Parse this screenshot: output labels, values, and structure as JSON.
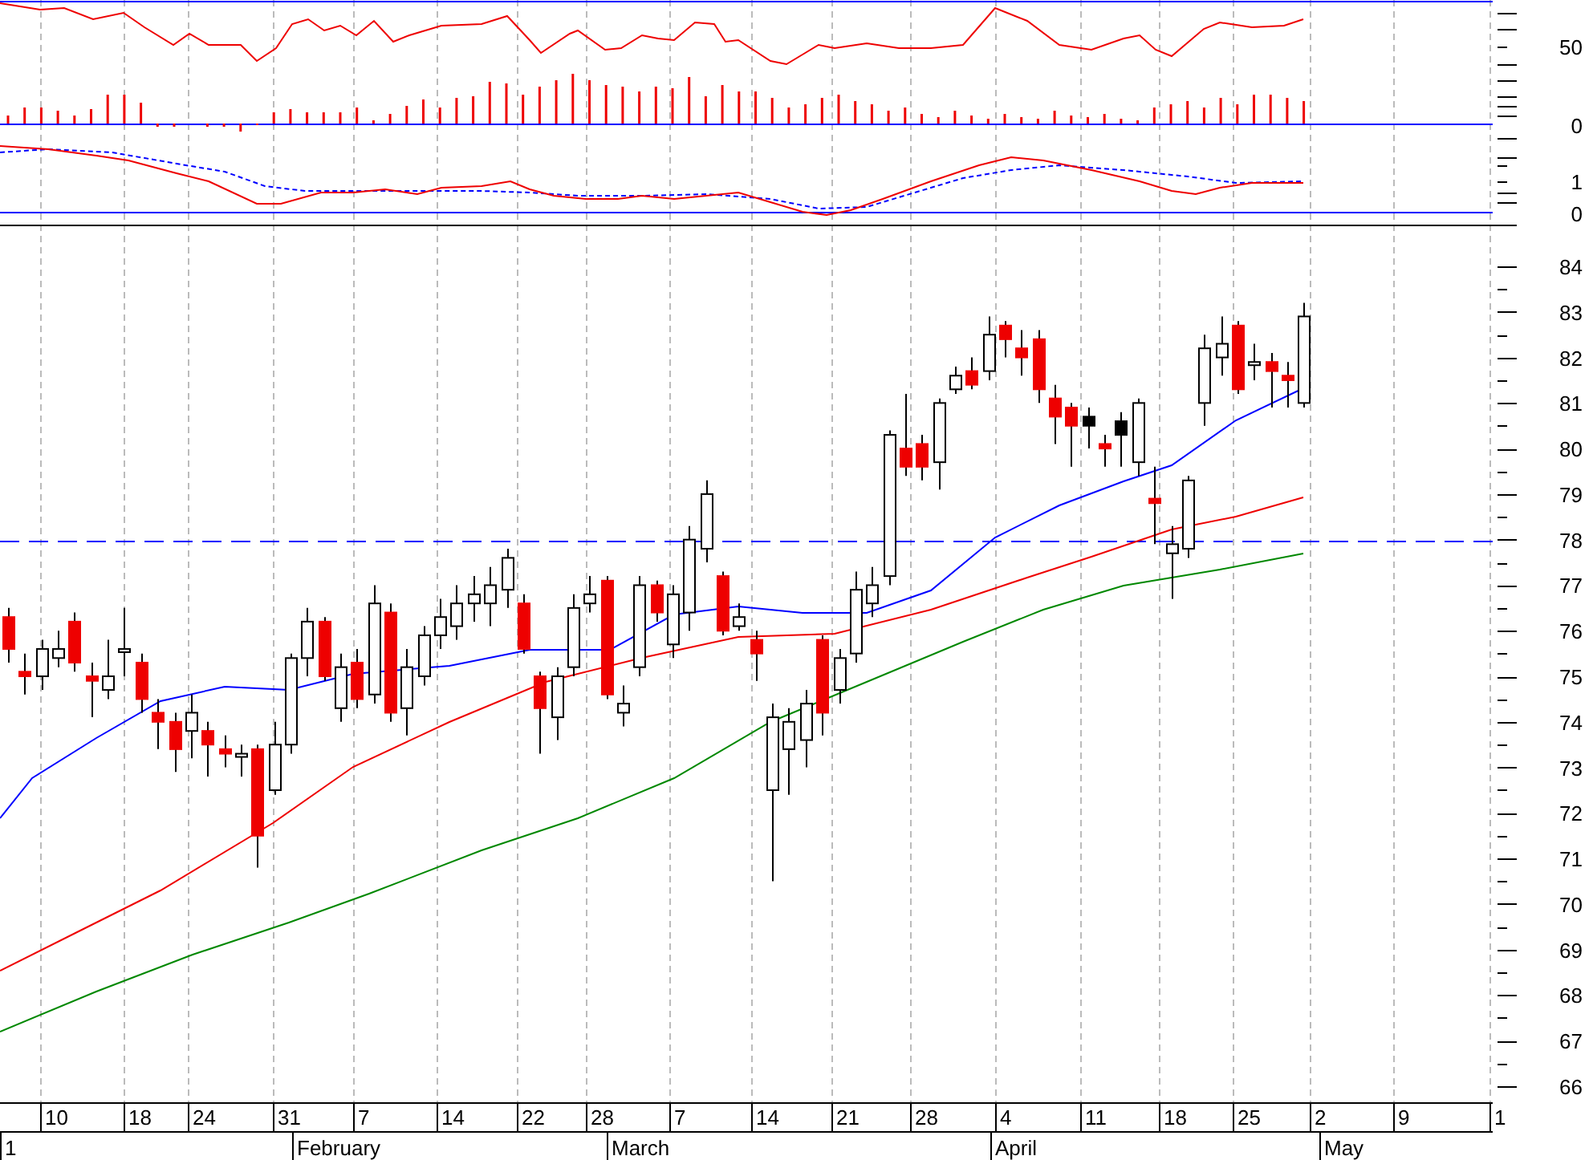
{
  "indicator_panel": {
    "axis_labels": [
      "50",
      "0"
    ]
  },
  "macd_panel": {
    "axis_labels": [
      "1",
      "0"
    ]
  },
  "price_panel": {
    "axis_labels": [
      "84",
      "83",
      "82",
      "81",
      "80",
      "79",
      "78",
      "77",
      "76",
      "75",
      "74",
      "73",
      "72",
      "71",
      "70",
      "69",
      "68",
      "67",
      "66"
    ]
  },
  "date_axis": {
    "days": [
      "10",
      "18",
      "24",
      "31",
      "7",
      "14",
      "22",
      "28",
      "7",
      "14",
      "21",
      "28",
      "4",
      "11",
      "18",
      "25",
      "2",
      "9",
      "1"
    ],
    "months": [
      "1",
      "February",
      "March",
      "April",
      "May"
    ]
  }
}
